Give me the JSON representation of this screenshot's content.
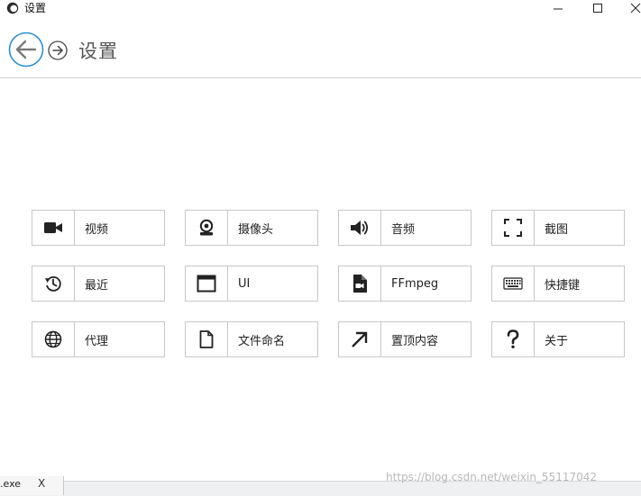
{
  "window": {
    "title": "设置",
    "icons": {
      "app": "app-logo-icon",
      "minimize": "minimize-icon",
      "maximize": "maximize-icon",
      "close": "close-icon"
    }
  },
  "header": {
    "title": "设置",
    "back_icon": "arrow-left-icon",
    "forward_icon": "arrow-right-icon",
    "accent_color": "#2f8fd1"
  },
  "tiles": [
    {
      "label": "视频",
      "icon": "video-camera-icon"
    },
    {
      "label": "摄像头",
      "icon": "webcam-icon"
    },
    {
      "label": "音频",
      "icon": "speaker-icon"
    },
    {
      "label": "截图",
      "icon": "screenshot-frame-icon"
    },
    {
      "label": "最近",
      "icon": "history-icon"
    },
    {
      "label": "UI",
      "icon": "window-icon"
    },
    {
      "label": "FFmpeg",
      "icon": "video-file-icon"
    },
    {
      "label": "快捷键",
      "icon": "keyboard-icon"
    },
    {
      "label": "代理",
      "icon": "globe-icon"
    },
    {
      "label": "文件命名",
      "icon": "file-icon"
    },
    {
      "label": "置顶内容",
      "icon": "arrow-up-right-icon"
    },
    {
      "label": "关于",
      "icon": "question-icon"
    }
  ],
  "taskbar": {
    "tab_label": ".exe",
    "close_glyph": "X"
  },
  "watermark": "https://blog.csdn.net/weixin_55117042"
}
